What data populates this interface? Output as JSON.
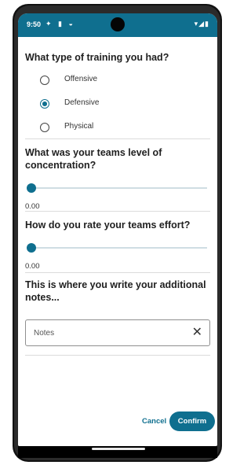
{
  "status_bar": {
    "time": "9:50",
    "left_icons": "✦ ▮ ◒",
    "right_icons": "▾◢▮"
  },
  "training_type": {
    "question": "What type of training you had?",
    "options": [
      {
        "label": "Offensive",
        "selected": false
      },
      {
        "label": "Defensive",
        "selected": true
      },
      {
        "label": "Physical",
        "selected": false
      }
    ]
  },
  "concentration": {
    "question": "What was your teams level of concentration?",
    "value_text": "0.00",
    "level_fraction": 0.0
  },
  "effort": {
    "question": "How do you rate your teams effort?",
    "value_text": "0.00",
    "level_fraction": 0.0
  },
  "notes": {
    "question": "This is where you write your additional notes...",
    "placeholder": "Notes",
    "clear_glyph": "✕"
  },
  "actions": {
    "cancel_label": "Cancel",
    "confirm_label": "Confirm"
  },
  "colors": {
    "accent": "#0f6f8f"
  }
}
